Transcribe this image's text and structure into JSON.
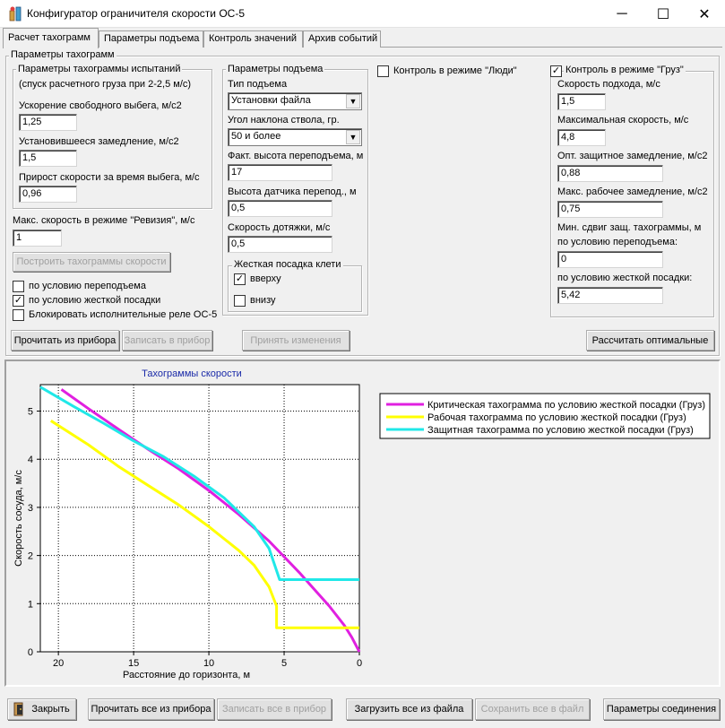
{
  "window": {
    "title": "Конфигуратор ограничителя скорости ОС-5",
    "minimize": "─",
    "maximize": "☐",
    "close": "✕"
  },
  "tabs": [
    "Расчет тахограмм",
    "Параметры подъема",
    "Контроль значений",
    "Архив событий"
  ],
  "params": {
    "group_title": "Параметры тахограмм",
    "test": {
      "title": "Параметры тахограммы испытаний",
      "subtitle": "(спуск расчетного груза при 2-2,5 м/с)",
      "freerun_label": "Ускорение свободного выбега, м/с2",
      "freerun_value": "1,25",
      "decel_label": "Установившееся замедление, м/с2",
      "decel_value": "1,5",
      "increase_label": "Прирост скорости за время выбега, м/с",
      "increase_value": "0,96"
    },
    "revision_label": "Макс. скорость в режиме \"Ревизия\", м/с",
    "revision_value": "1",
    "build_button": "Построить тахограммы скорости",
    "checks": [
      {
        "label": "по условию переподъема",
        "checked": false
      },
      {
        "label": "по условию жесткой посадки",
        "checked": true
      },
      {
        "label": "Блокировать исполнительные реле ОС-5",
        "checked": false
      }
    ],
    "lift": {
      "title": "Параметры подъема",
      "type_label": "Тип подъема",
      "type_value": "Установки файла",
      "angle_label": "Угол наклона ствола, гр.",
      "angle_value": "50 и более",
      "height_label": "Факт. высота переподъема, м",
      "height_value": "17",
      "sensor_label": "Высота датчика перепод., м",
      "sensor_value": "0,5",
      "finish_label": "Скорость дотяжки, м/с",
      "finish_value": "0,5",
      "landing": {
        "title": "Жесткая посадка клети",
        "top_label": "вверху",
        "top_checked": true,
        "bottom_label": "внизу",
        "bottom_checked": false
      }
    },
    "people": {
      "label": "Контроль в режиме \"Люди\"",
      "checked": false
    },
    "cargo": {
      "label": "Контроль в режиме \"Груз\"",
      "checked": true,
      "approach_label": "Скорость подхода, м/с",
      "approach_value": "1,5",
      "maxspeed_label": "Максимальная скорость, м/с",
      "maxspeed_value": "4,8",
      "optdecel_label": "Опт. защитное замедление, м/с2",
      "optdecel_value": "0,88",
      "maxdecel_label": "Макс. рабочее замедление, м/с2",
      "maxdecel_value": "0,75",
      "minshift_label1": "Мин. сдвиг защ. тахограммы, м",
      "minshift_label2": "по условию переподъема:",
      "minshift_value1": "0",
      "minshift_label3": "по условию жесткой посадки:",
      "minshift_value2": "5,42"
    },
    "buttons": {
      "read": "Прочитать из прибора",
      "write": "Записать в прибор",
      "accept": "Принять изменения",
      "calc": "Рассчитать оптимальные"
    }
  },
  "chart_data": {
    "type": "line",
    "title": "Тахограммы скорости",
    "xlabel": "Расстояние до горизонта, м",
    "ylabel": "Скорость сосуда, м/с",
    "xlim": [
      21.2,
      0
    ],
    "ylim": [
      0,
      5.55
    ],
    "xticks": [
      20,
      15,
      10,
      5,
      0
    ],
    "yticks": [
      0,
      1,
      2,
      3,
      4,
      5
    ],
    "grid": true,
    "legend": "top-right",
    "series": [
      {
        "name": "Критическая тахограмма по условию жесткой посадки (Груз)",
        "color": "#e020e0",
        "x": [
          19.8,
          18,
          16,
          14,
          12,
          10,
          8,
          6,
          4,
          3,
          2,
          1,
          0.5,
          0
        ],
        "y": [
          5.45,
          5.05,
          4.62,
          4.2,
          3.8,
          3.35,
          2.85,
          2.3,
          1.65,
          1.3,
          0.95,
          0.55,
          0.3,
          0
        ]
      },
      {
        "name": "Рабочая тахограмма по условию жесткой посадки (Груз)",
        "color": "#ffff00",
        "x": [
          20.5,
          18,
          16,
          14,
          12,
          10,
          8,
          7,
          6,
          5.5,
          5.5,
          0
        ],
        "y": [
          4.8,
          4.3,
          3.85,
          3.45,
          3.05,
          2.6,
          2.1,
          1.8,
          1.35,
          0.95,
          0.5,
          0.5
        ]
      },
      {
        "name": "Защитная тахограмма по условию жесткой посадки (Груз)",
        "color": "#20e8e8",
        "x": [
          21.2,
          19,
          17,
          15,
          13,
          11,
          9,
          7,
          6,
          5.3,
          5.3,
          0
        ],
        "y": [
          5.5,
          5.1,
          4.75,
          4.38,
          4.05,
          3.65,
          3.2,
          2.6,
          2.15,
          1.5,
          1.5,
          1.5
        ]
      }
    ]
  },
  "footer": {
    "close": "Закрыть",
    "read_all": "Прочитать все из прибора",
    "write_all": "Записать все в прибор",
    "load_file": "Загрузить все из файла",
    "save_file": "Сохранить все в файл",
    "conn": "Параметры соединения"
  }
}
